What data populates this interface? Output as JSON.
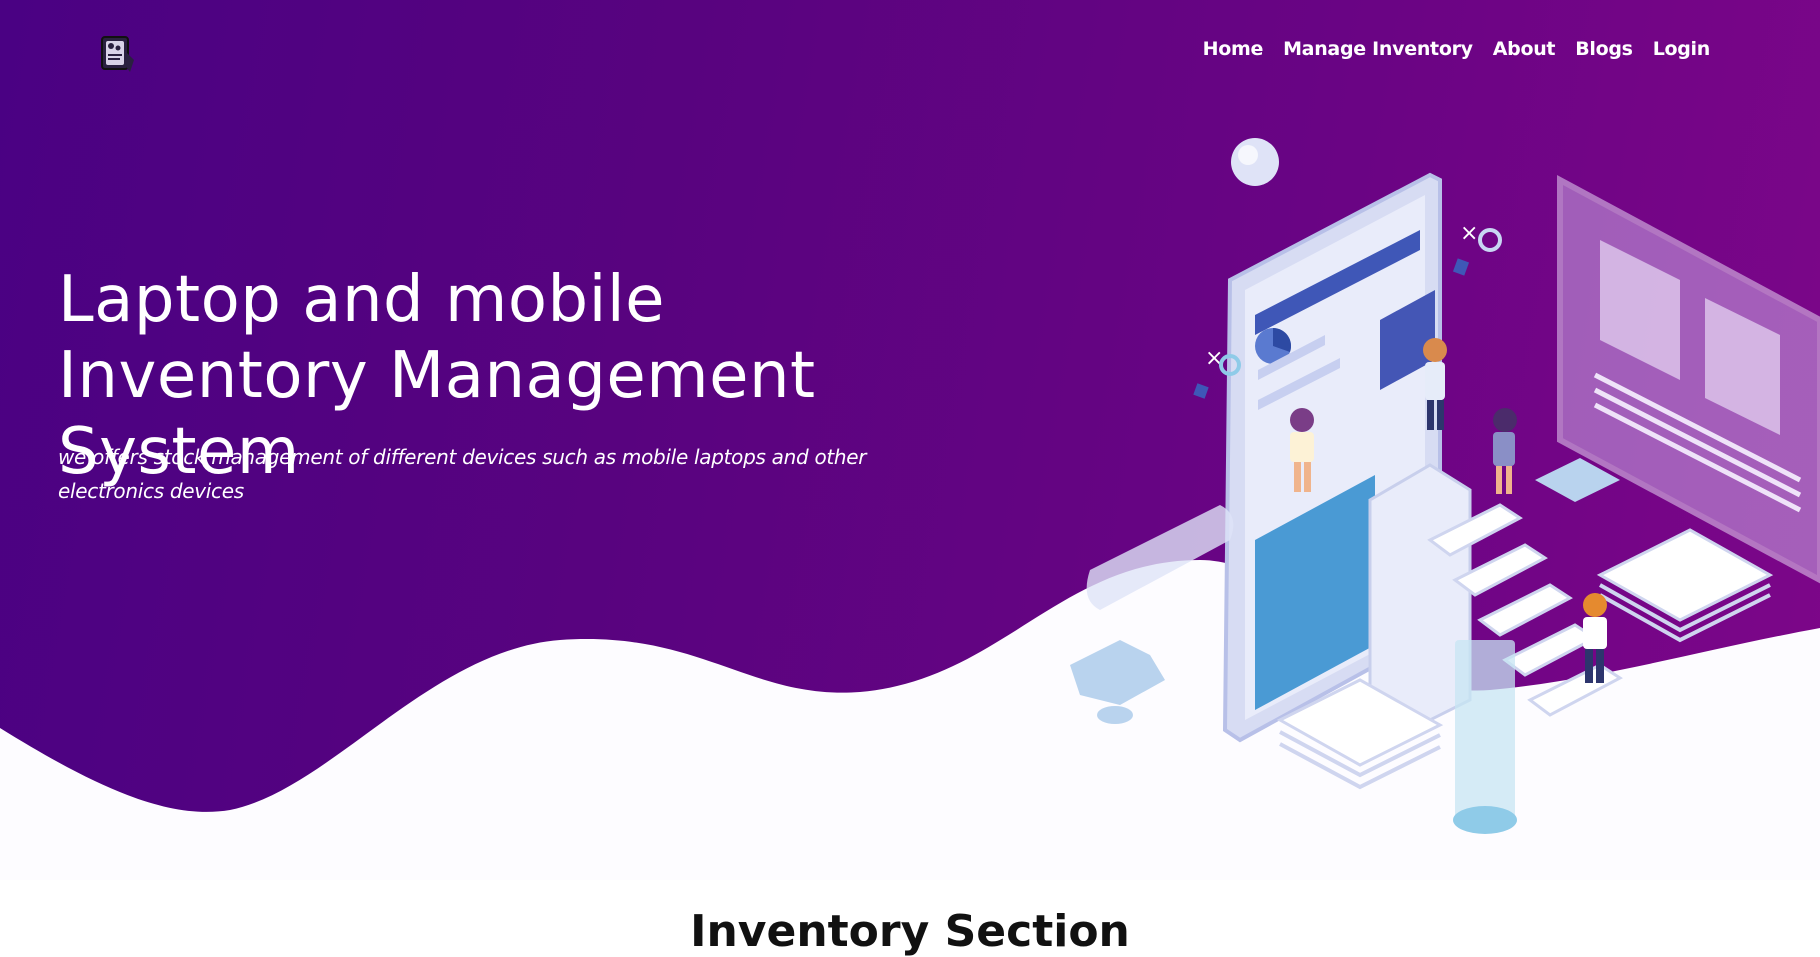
{
  "brand": {
    "logo_icon": "inventory-logo-icon"
  },
  "nav": {
    "items": [
      {
        "label": "Home"
      },
      {
        "label": "Manage Inventory"
      },
      {
        "label": "About"
      },
      {
        "label": "Blogs"
      },
      {
        "label": "Login"
      }
    ]
  },
  "hero": {
    "title": "Laptop and mobile Inventory Management System",
    "subtitle": "we offers stock management of different devices such as mobile laptops and other electronics devices",
    "illustration_icon": "isometric-inventory-illustration"
  },
  "section": {
    "heading": "Inventory Section"
  },
  "colors": {
    "hero_gradient_start": "#4a0183",
    "hero_gradient_end": "#7d0689",
    "wave_fill": "#fdfcff",
    "text": "#ffffff"
  }
}
